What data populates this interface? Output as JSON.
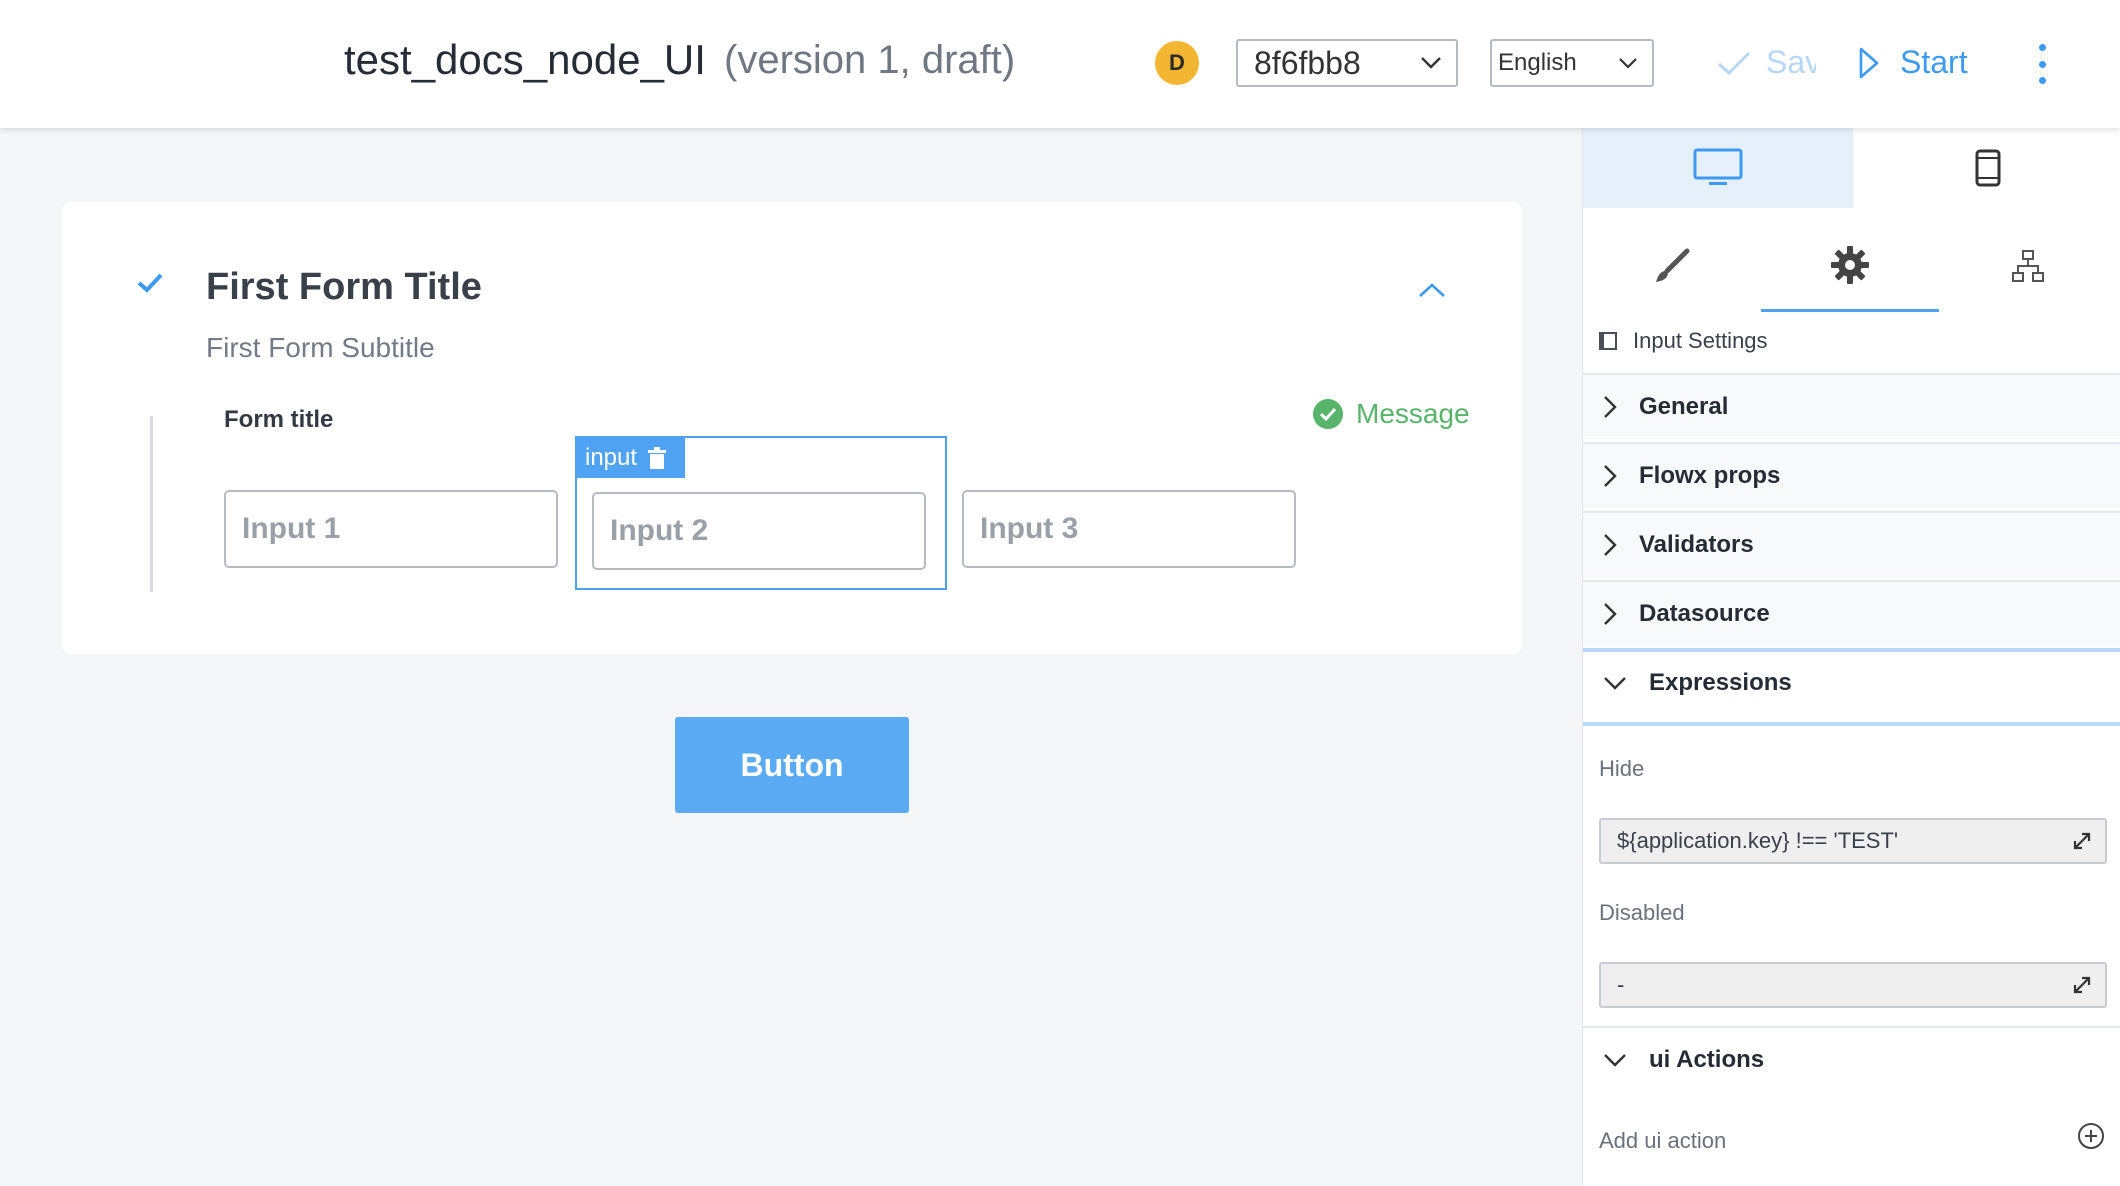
{
  "header": {
    "title": "test_docs_node_UI",
    "version_text": "(version 1, draft)",
    "avatar_initial": "D",
    "version_select": "8f6fbb8",
    "language_select": "English",
    "save_label": "Save",
    "start_label": "Start"
  },
  "form": {
    "title": "First Form Title",
    "subtitle": "First Form Subtitle",
    "inner_title": "Form title",
    "message": "Message",
    "inputs": [
      "Input 1",
      "Input 2",
      "Input 3"
    ],
    "selected_tag": "input",
    "button_label": "Button"
  },
  "panel": {
    "settings_label": "Input Settings",
    "sections": [
      "General",
      "Flowx props",
      "Validators",
      "Datasource",
      "Expressions"
    ],
    "hide_label": "Hide",
    "hide_value": "${application.key} !== 'TEST'",
    "disabled_label": "Disabled",
    "disabled_value": "-",
    "ui_actions_label": "ui Actions",
    "add_ui_action": "Add ui action"
  },
  "colors": {
    "accent": "#4fa3f2",
    "button": "#5aabf4",
    "success": "#58b46a",
    "avatar": "#f2b632"
  }
}
